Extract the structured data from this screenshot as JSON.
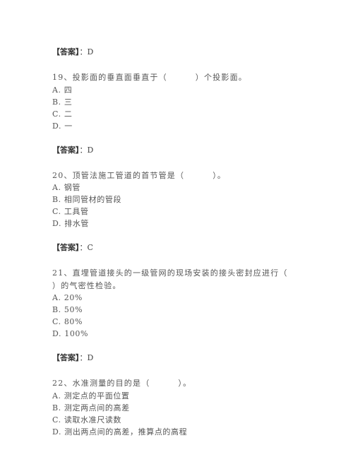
{
  "items": [
    {
      "answer_label": "【答案】",
      "answer_sep": "：",
      "answer_value": "D"
    },
    {
      "question_text": "19、投影面的垂直面垂直于（",
      "question_after": "）个投影面。",
      "options": [
        "A. 四",
        "B. 三",
        "C. 二",
        "D. 一"
      ],
      "answer_label": "【答案】",
      "answer_sep": "：",
      "answer_value": "D"
    },
    {
      "question_text": "20、顶管法施工管道的首节管是（",
      "question_after": "）。",
      "options": [
        "A. 钢管",
        "B. 相同管材的管段",
        "C. 工具管",
        "D. 排水管"
      ],
      "answer_label": "【答案】",
      "answer_sep": "：",
      "answer_value": "C"
    },
    {
      "question_line1": "21、直埋管道接头的一级管网的现场安装的接头密封应进行（",
      "question_line2": "）的气密性检验。",
      "options": [
        "A. 20%",
        "B. 50%",
        "C. 80%",
        "D. 100%"
      ],
      "answer_label": "【答案】",
      "answer_sep": "：",
      "answer_value": "D"
    },
    {
      "question_text": "22、水准测量的目的是（",
      "question_after": "）。",
      "options": [
        "A. 测定点的平面位置",
        "B. 测定两点间的高差",
        "C. 读取水准尺读数",
        "D. 测出两点间的高差，推算点的高程"
      ]
    }
  ]
}
